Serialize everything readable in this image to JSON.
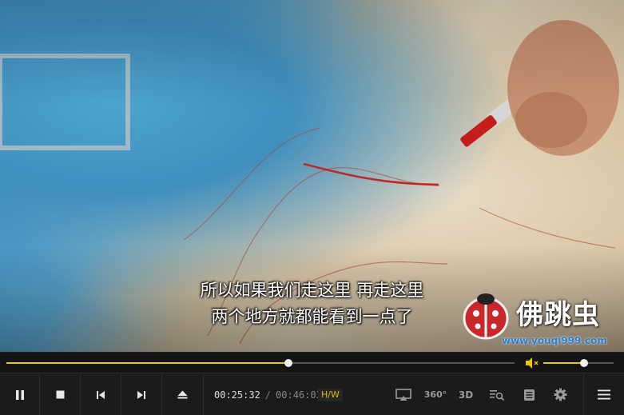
{
  "subtitles": {
    "line1": "所以如果我们走这里 再走这里",
    "line2": "两个地方就都能看到一点了"
  },
  "watermark": {
    "name": "佛跳虫",
    "url": "www.youqi999.com"
  },
  "playback": {
    "current_time": "00:25:32",
    "separator": "/",
    "duration": "00:46:03",
    "decoder_label": "H/W",
    "progress": 0.555,
    "volume": 0.58
  },
  "controls": {
    "pause": "pause-icon",
    "stop": "stop-icon",
    "previous": "skip-previous-icon",
    "next": "skip-next-icon",
    "eject": "eject-icon",
    "cast": "cast-icon",
    "vr360_label": "360°",
    "stereo3d_label": "3D",
    "playlist_search": "playlist-search-icon",
    "chapters": "chapters-icon",
    "settings": "gear-icon",
    "menu": "hamburger-menu-icon"
  },
  "colors": {
    "accent": "#e8c900",
    "bar_bg": "#1b1b1b"
  }
}
